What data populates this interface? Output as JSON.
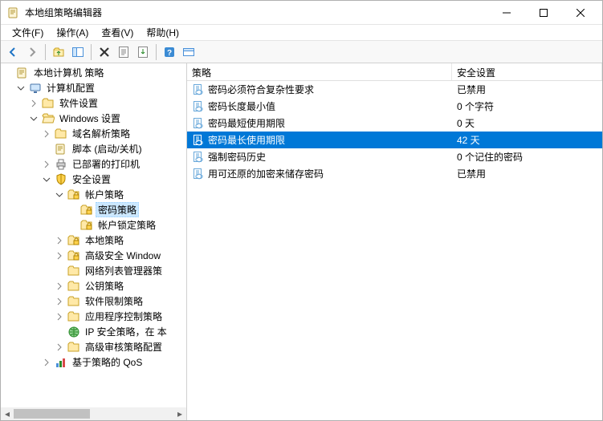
{
  "window": {
    "title": "本地组策略编辑器"
  },
  "menubar": {
    "file": "文件(F)",
    "action": "操作(A)",
    "view": "查看(V)",
    "help": "帮助(H)"
  },
  "tree": {
    "root": "本地计算机 策略",
    "computer_config": "计算机配置",
    "software_settings": "软件设置",
    "windows_settings": "Windows 设置",
    "dns_policy": "域名解析策略",
    "scripts": "脚本 (启动/关机)",
    "deployed_printers": "已部署的打印机",
    "security_settings": "安全设置",
    "account_policies": "帐户策略",
    "password_policy": "密码策略",
    "lockout_policy": "帐户锁定策略",
    "local_policies": "本地策略",
    "wf_advanced": "高级安全 Window",
    "nlm_policies": "网络列表管理器策",
    "pk_policies": "公钥策略",
    "srp": "软件限制策略",
    "acp": "应用程序控制策略",
    "ipsec": "IP 安全策略，在 本",
    "audit": "高级审核策略配置",
    "qos": "基于策略的 QoS"
  },
  "list": {
    "header_policy": "策略",
    "header_setting": "安全设置",
    "rows": [
      {
        "policy": "密码必须符合复杂性要求",
        "setting": "已禁用"
      },
      {
        "policy": "密码长度最小值",
        "setting": "0 个字符"
      },
      {
        "policy": "密码最短使用期限",
        "setting": "0 天"
      },
      {
        "policy": "密码最长使用期限",
        "setting": "42 天"
      },
      {
        "policy": "强制密码历史",
        "setting": "0 个记住的密码"
      },
      {
        "policy": "用可还原的加密来储存密码",
        "setting": "已禁用"
      }
    ],
    "selected_index": 3
  }
}
